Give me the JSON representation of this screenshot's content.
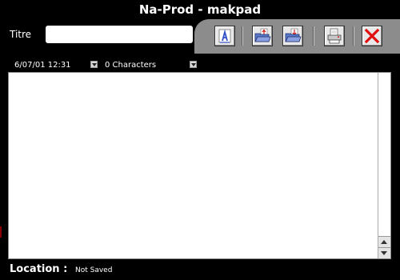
{
  "window": {
    "title": "Na-Prod - makpad"
  },
  "toolbar": {
    "titre_label": "Titre",
    "titre_value": "",
    "buttons": [
      {
        "name": "font-button",
        "icon": "font-icon"
      },
      {
        "name": "open-button",
        "icon": "folder-open-icon"
      },
      {
        "name": "save-button",
        "icon": "folder-save-icon"
      },
      {
        "name": "print-button",
        "icon": "printer-icon"
      },
      {
        "name": "close-button",
        "icon": "close-icon"
      }
    ]
  },
  "status": {
    "date": "6/07/01 12:31",
    "characters": "0 Characters"
  },
  "editor": {
    "text": ""
  },
  "footer": {
    "location_label": "Location :",
    "location_value": "Not Saved"
  },
  "colors": {
    "window_bg": "#000000",
    "toolbar_panel": "#8c8c8c",
    "close_red": "#e01010",
    "folder_blue": "#5a78c8"
  }
}
